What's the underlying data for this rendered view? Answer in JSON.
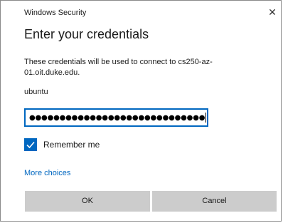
{
  "window": {
    "title": "Windows Security",
    "close_glyph": "✕"
  },
  "dialog": {
    "heading": "Enter your credentials",
    "description": "These credentials will be used to connect to cs250-az-01.oit.duke.edu.",
    "username": "ubuntu",
    "password_masked": "●●●●●●●●●●●●●●●●●●●●●●●●●●●●●",
    "remember_me": {
      "label": "Remember me",
      "checked": true
    },
    "more_choices": "More choices",
    "ok_label": "OK",
    "cancel_label": "Cancel"
  },
  "colors": {
    "accent": "#0067c0",
    "button_bg": "#cccccc"
  }
}
